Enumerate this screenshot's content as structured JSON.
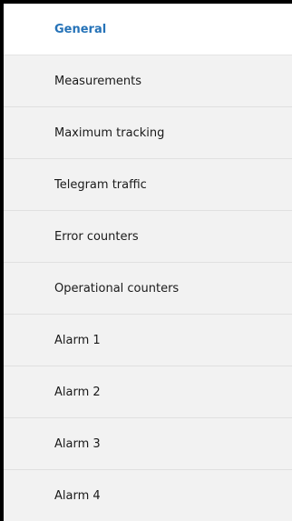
{
  "sidebar": {
    "items": [
      {
        "label": "General",
        "active": true
      },
      {
        "label": "Measurements",
        "active": false
      },
      {
        "label": "Maximum tracking",
        "active": false
      },
      {
        "label": "Telegram traffic",
        "active": false
      },
      {
        "label": "Error counters",
        "active": false
      },
      {
        "label": "Operational counters",
        "active": false
      },
      {
        "label": "Alarm 1",
        "active": false
      },
      {
        "label": "Alarm 2",
        "active": false
      },
      {
        "label": "Alarm 3",
        "active": false
      },
      {
        "label": "Alarm 4",
        "active": false
      }
    ]
  },
  "colors": {
    "active_text": "#2673b8",
    "inactive_background": "#f2f2f2",
    "active_background": "#ffffff"
  }
}
